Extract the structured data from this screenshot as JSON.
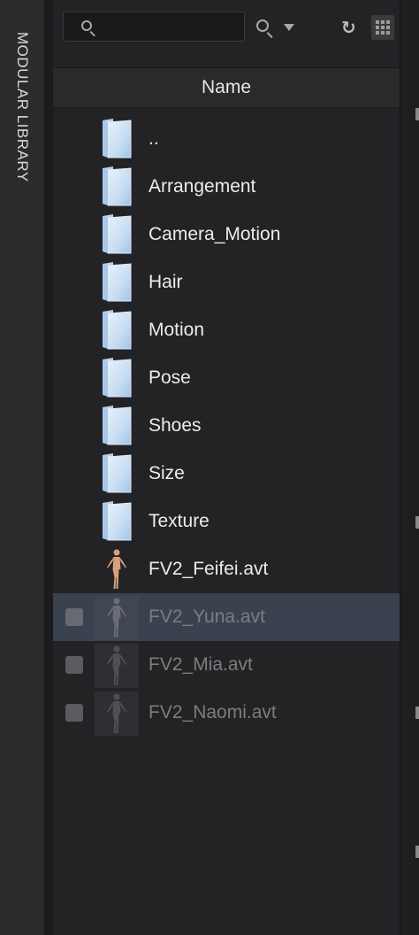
{
  "side_tab": {
    "label": "MODULAR LIBRARY"
  },
  "search": {
    "value": "",
    "placeholder": ""
  },
  "header": {
    "name_column": "Name"
  },
  "items": [
    {
      "label": "..",
      "type": "folder"
    },
    {
      "label": "Arrangement",
      "type": "folder"
    },
    {
      "label": "Camera_Motion",
      "type": "folder"
    },
    {
      "label": "Hair",
      "type": "folder"
    },
    {
      "label": "Motion",
      "type": "folder"
    },
    {
      "label": "Pose",
      "type": "folder"
    },
    {
      "label": "Shoes",
      "type": "folder"
    },
    {
      "label": "Size",
      "type": "folder"
    },
    {
      "label": "Texture",
      "type": "folder"
    },
    {
      "label": "FV2_Feifei.avt",
      "type": "avatar"
    },
    {
      "label": "FV2_Yuna.avt",
      "type": "avatar",
      "selected": true,
      "dimmed": true
    },
    {
      "label": "FV2_Mia.avt",
      "type": "avatar",
      "dimmed": true
    },
    {
      "label": "FV2_Naomi.avt",
      "type": "avatar",
      "dimmed": true
    }
  ],
  "icons": {
    "search": "search-icon",
    "search_options": "search-options-icon",
    "refresh": "refresh-icon",
    "grid_view": "grid-view-icon",
    "folder": "folder-icon",
    "avatar": "avatar-icon"
  },
  "colors": {
    "selection": "#3a4250",
    "folder_light": "#e8f2fb",
    "folder_blue": "#9fc3e6",
    "skin": "#d9a07e"
  }
}
